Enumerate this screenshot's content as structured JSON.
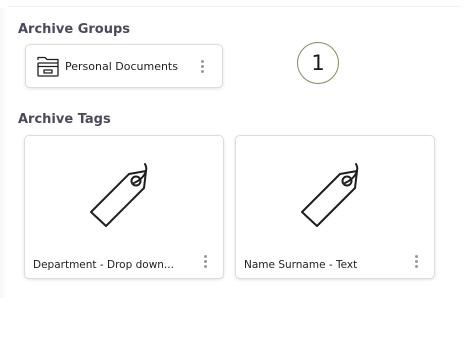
{
  "sections": {
    "groups_title": "Archive Groups",
    "tags_title": "Archive Tags"
  },
  "groups": [
    {
      "label": "Personal Documents",
      "icon": "archive-folder-icon"
    }
  ],
  "step_badge": "1",
  "tags": [
    {
      "label": "Department - Drop down...",
      "icon": "tag-icon"
    },
    {
      "label": "Name Surname - Text",
      "icon": "tag-icon"
    }
  ],
  "colors": {
    "badge_border": "#7a8f5f",
    "card_border": "#dcdcdc",
    "section_title": "#4a4a5a",
    "kebab": "#9a9a9a"
  }
}
